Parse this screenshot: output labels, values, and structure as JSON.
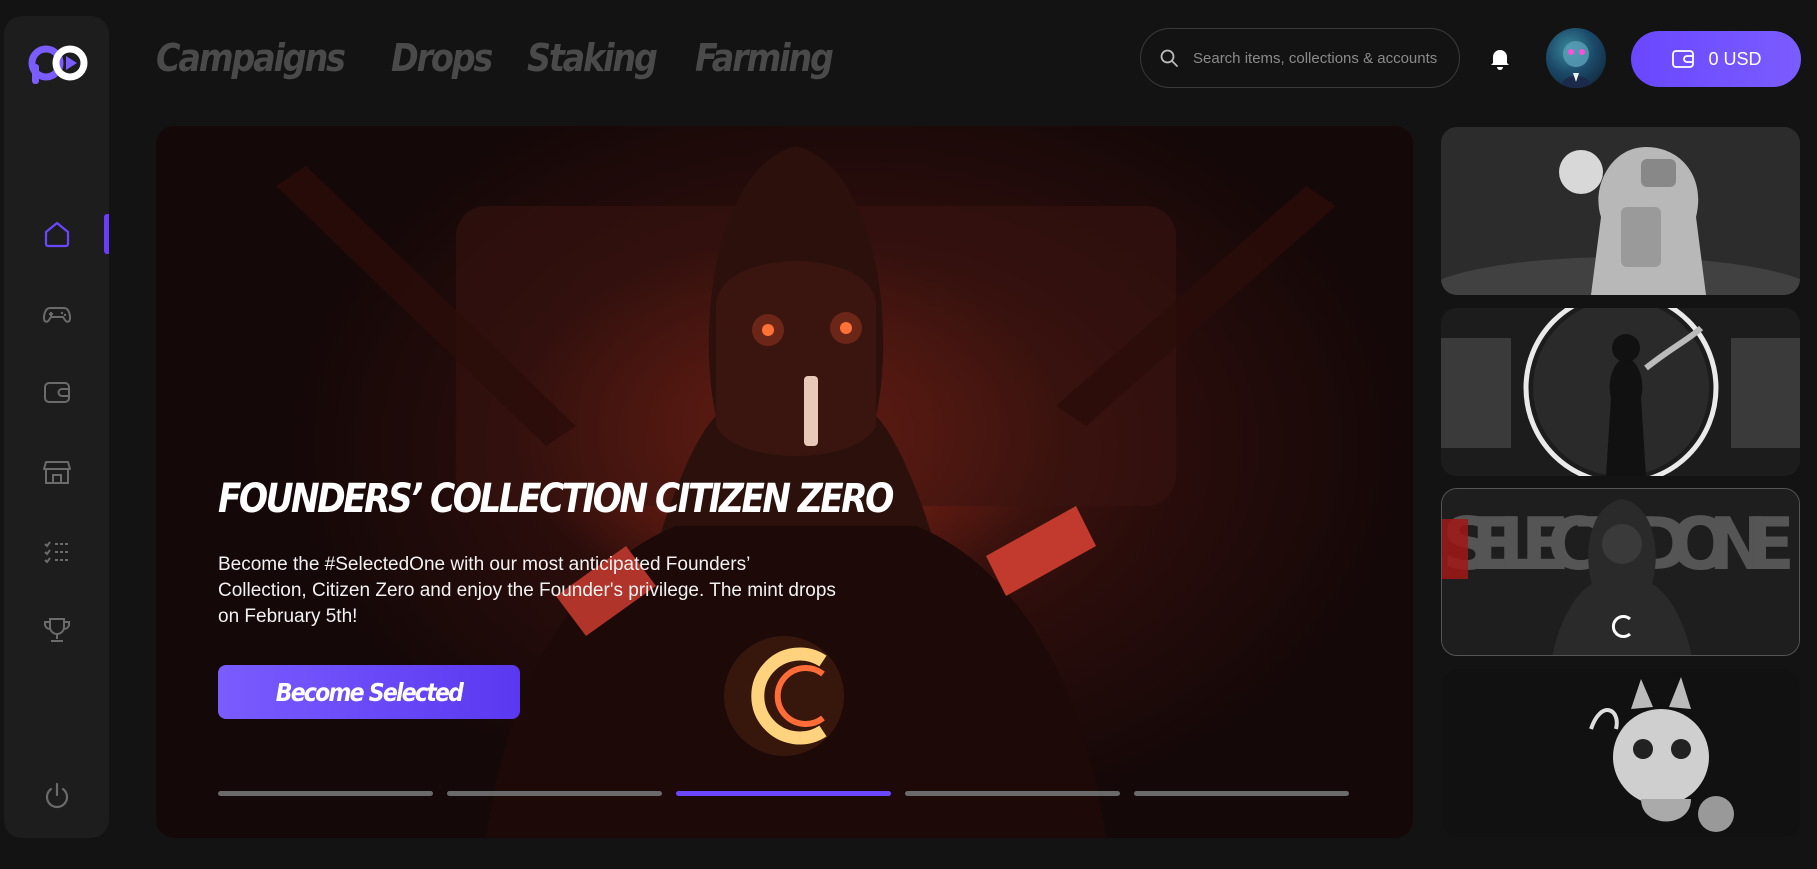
{
  "brand": {
    "name": "logo",
    "accent": "#6a47ff"
  },
  "sidebar": {
    "items": [
      {
        "name": "home",
        "icon": "home-icon",
        "active": true
      },
      {
        "name": "games",
        "icon": "gamepad-icon",
        "active": false
      },
      {
        "name": "wallet",
        "icon": "wallet-icon",
        "active": false
      },
      {
        "name": "marketplace",
        "icon": "store-icon",
        "active": false
      },
      {
        "name": "tasks",
        "icon": "checklist-icon",
        "active": false
      },
      {
        "name": "rewards",
        "icon": "trophy-icon",
        "active": false
      }
    ],
    "logout_icon": "power-icon"
  },
  "topnav": {
    "items": [
      "Campaigns",
      "Drops",
      "Staking",
      "Farming"
    ]
  },
  "search": {
    "placeholder": "Search items, collections & accounts"
  },
  "header": {
    "notification_icon": "bell-icon",
    "avatar_icon": "avatar",
    "balance": "0 USD"
  },
  "hero": {
    "title": "FOUNDERS’ COLLECTION CITIZEN ZERO",
    "description": "Become the #SelectedOne with our most anticipated Founders’ Collection, Citizen Zero and enjoy the Founder's privilege. The mint drops on February 5th!",
    "cta_label": "Become Selected",
    "slide_count": 5,
    "active_slide": 3
  },
  "cards": [
    {
      "name": "card-robot"
    },
    {
      "name": "card-portal-hero"
    },
    {
      "name": "card-selected-one",
      "text": "SELECTED ONE"
    },
    {
      "name": "card-creature"
    }
  ]
}
